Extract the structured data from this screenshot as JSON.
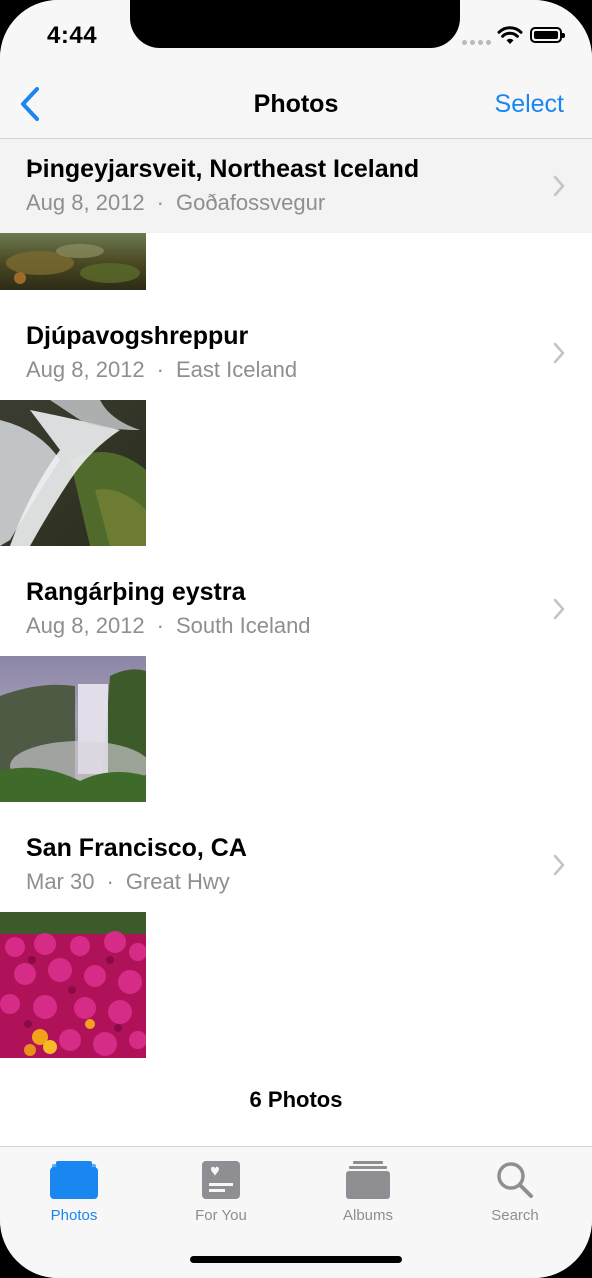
{
  "status_bar": {
    "time": "4:44"
  },
  "nav": {
    "back_icon": "chevron-left-icon",
    "title": "Photos",
    "select_label": "Select"
  },
  "sections": [
    {
      "title": "Þingeyjarsveit, Northeast Iceland",
      "date": "Aug 8, 2012",
      "place": "Goðafossvegur"
    },
    {
      "title": "Djúpavogshreppur",
      "date": "Aug 8, 2012",
      "place": "East Iceland"
    },
    {
      "title": "Rangárþing eystra",
      "date": "Aug 8, 2012",
      "place": "South Iceland"
    },
    {
      "title": "San Francisco, CA",
      "date": "Mar 30",
      "place": "Great Hwy"
    }
  ],
  "footer": {
    "count": "6 Photos"
  },
  "tabs": [
    {
      "label": "Photos",
      "icon": "photos-stack-icon",
      "active": true
    },
    {
      "label": "For You",
      "icon": "for-you-icon",
      "active": false
    },
    {
      "label": "Albums",
      "icon": "albums-icon",
      "active": false
    },
    {
      "label": "Search",
      "icon": "search-icon",
      "active": false
    }
  ],
  "colors": {
    "accent": "#1a86f0",
    "secondary_text": "#8e8e93",
    "bar_background": "#f7f7f7"
  }
}
